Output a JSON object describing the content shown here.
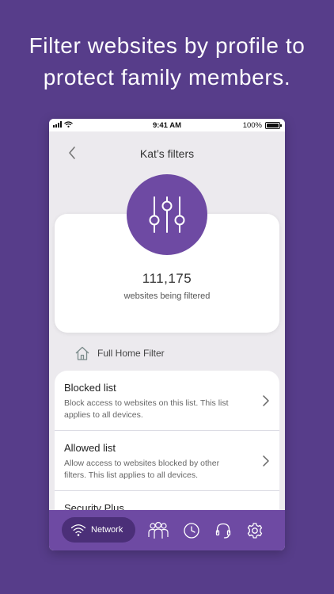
{
  "headline": {
    "line1": "Filter websites by profile to",
    "line2": "protect family members."
  },
  "status_bar": {
    "time": "9:41 AM",
    "battery": "100%"
  },
  "nav": {
    "title": "Kat’s filters",
    "back_icon": "chevron-left-icon"
  },
  "summary": {
    "icon": "sliders-icon",
    "count": "111,175",
    "label": "websites being filtered"
  },
  "home_filter": {
    "icon": "house-icon",
    "label": "Full Home Filter"
  },
  "list": [
    {
      "title": "Blocked list",
      "desc_line1": "Block access to websites on this list. This list",
      "desc_line2": "applies to all devices."
    },
    {
      "title": "Allowed list",
      "desc_line1": "Allow access to websites blocked by other",
      "desc_line2": "filters. This list applies to all devices."
    },
    {
      "title": "Security Plus",
      "desc_line1": "",
      "desc_line2": ""
    }
  ],
  "tabbar": {
    "active_label": "Network",
    "tabs": [
      "wifi-icon",
      "people-icon",
      "clock-icon",
      "headset-icon",
      "gear-icon"
    ]
  },
  "colors": {
    "background": "#573d8a",
    "accent": "#6e4aa3",
    "active_tab": "#4b2f78"
  }
}
